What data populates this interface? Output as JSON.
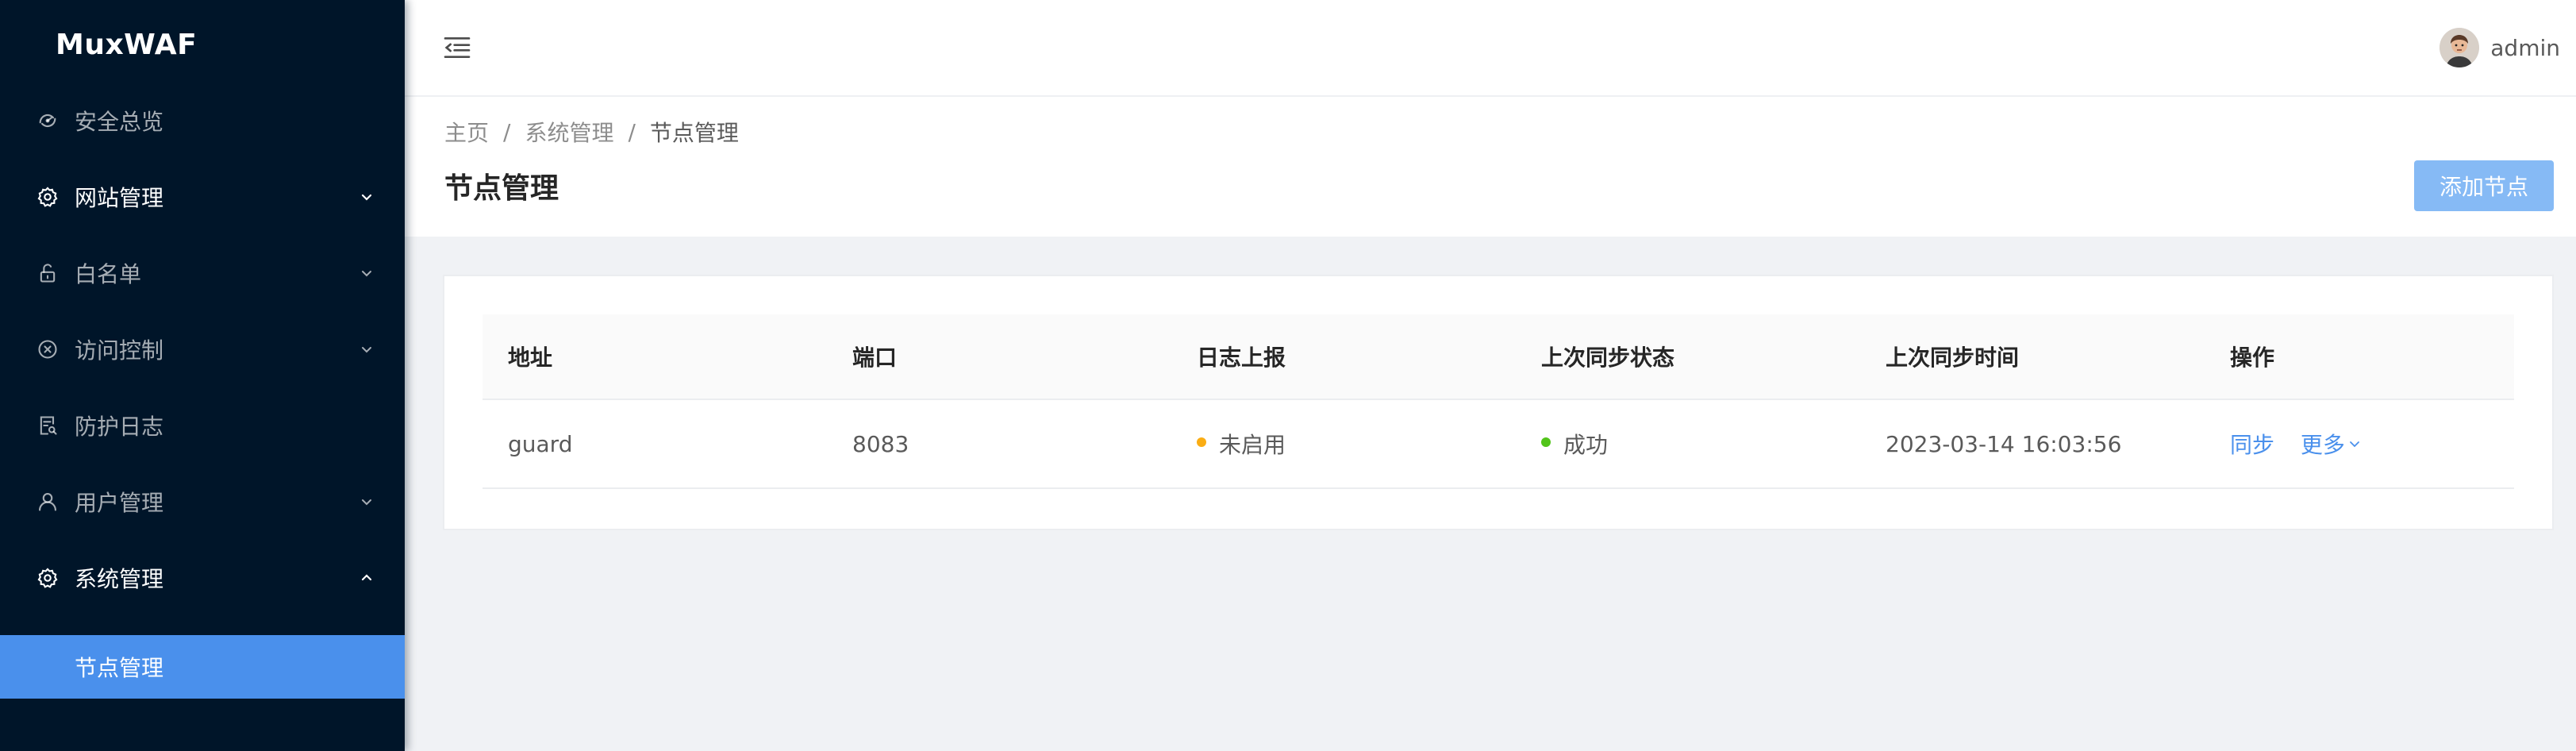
{
  "app": {
    "name": "MuxWAF"
  },
  "sidebar": {
    "items": [
      {
        "label": "安全总览",
        "icon": "dashboard-icon",
        "has_children": false,
        "expanded": false
      },
      {
        "label": "网站管理",
        "icon": "gear-icon",
        "has_children": true,
        "expanded": false
      },
      {
        "label": "白名单",
        "icon": "unlock-icon",
        "has_children": true,
        "expanded": false
      },
      {
        "label": "访问控制",
        "icon": "close-circle-icon",
        "has_children": true,
        "expanded": false
      },
      {
        "label": "防护日志",
        "icon": "file-search-icon",
        "has_children": false,
        "expanded": false
      },
      {
        "label": "用户管理",
        "icon": "user-icon",
        "has_children": true,
        "expanded": false
      },
      {
        "label": "系统管理",
        "icon": "gear-icon",
        "has_children": true,
        "expanded": true
      }
    ],
    "active_subitem": {
      "label": "节点管理"
    }
  },
  "header": {
    "fold_icon": "menu-fold-icon",
    "user": {
      "name": "admin",
      "avatar_icon": "avatar-icon"
    }
  },
  "breadcrumb": [
    "主页",
    "系统管理",
    "节点管理"
  ],
  "page": {
    "title": "节点管理",
    "add_button": "添加节点"
  },
  "table": {
    "columns": [
      "地址",
      "端口",
      "日志上报",
      "上次同步状态",
      "上次同步时间",
      "操作"
    ],
    "rows": [
      {
        "address": "guard",
        "port": "8083",
        "log_report": {
          "text": "未启用",
          "color": "#faad14"
        },
        "sync_status": {
          "text": "成功",
          "color": "#52c41a"
        },
        "sync_time": "2023-03-14 16:03:56",
        "actions": {
          "sync": "同步",
          "more": "更多"
        }
      }
    ]
  },
  "colors": {
    "sidebar_bg": "#001529",
    "primary": "#4a90ec",
    "button_disabled": "#86baf5"
  }
}
